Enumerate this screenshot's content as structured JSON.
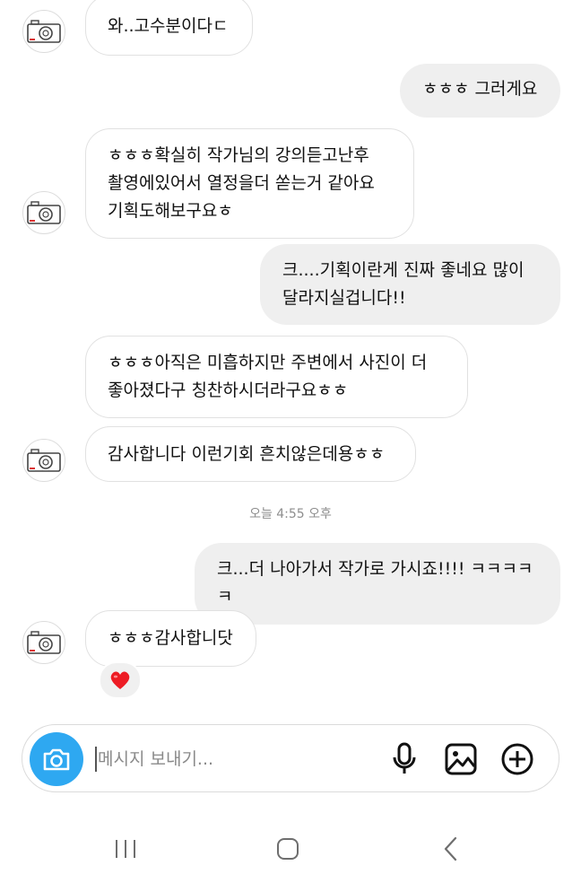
{
  "messages": [
    {
      "from": "them",
      "text": "와..고수분이다ㄷ"
    },
    {
      "from": "me",
      "text": "ㅎㅎㅎ 그러게요"
    },
    {
      "from": "them",
      "text": "ㅎㅎㅎ확실히 작가님의 강의듣고난후\n촬영에있어서 열정을더 쏟는거 같아요\n기획도해보구요ㅎ"
    },
    {
      "from": "me",
      "text": "크....기획이란게 진짜 좋네요 많이\n달라지실겁니다!!"
    },
    {
      "from": "them",
      "text": "ㅎㅎㅎ아직은 미흡하지만  주변에서 사진이 더\n좋아졌다구 칭찬하시더라구요ㅎㅎ"
    },
    {
      "from": "them",
      "text": "감사합니다 이런기회 흔치않은데용ㅎㅎ"
    },
    {
      "from": "me",
      "text": "크...더 나아가서 작가로 가시죠!!!! ㅋㅋㅋㅋㅋ"
    },
    {
      "from": "them",
      "text": "ㅎㅎㅎ감사합니닷"
    }
  ],
  "timestamp": "오늘 4:55 오후",
  "reaction": {
    "emoji": "heart",
    "color": "#ed1c24"
  },
  "composer": {
    "placeholder": "메시지 보내기...",
    "accent": "#2ea8f1",
    "icons": [
      "camera-icon",
      "microphone-icon",
      "gallery-icon",
      "add-icon"
    ]
  },
  "nav": {
    "icons": [
      "recent-apps-icon",
      "home-icon",
      "back-icon"
    ]
  }
}
